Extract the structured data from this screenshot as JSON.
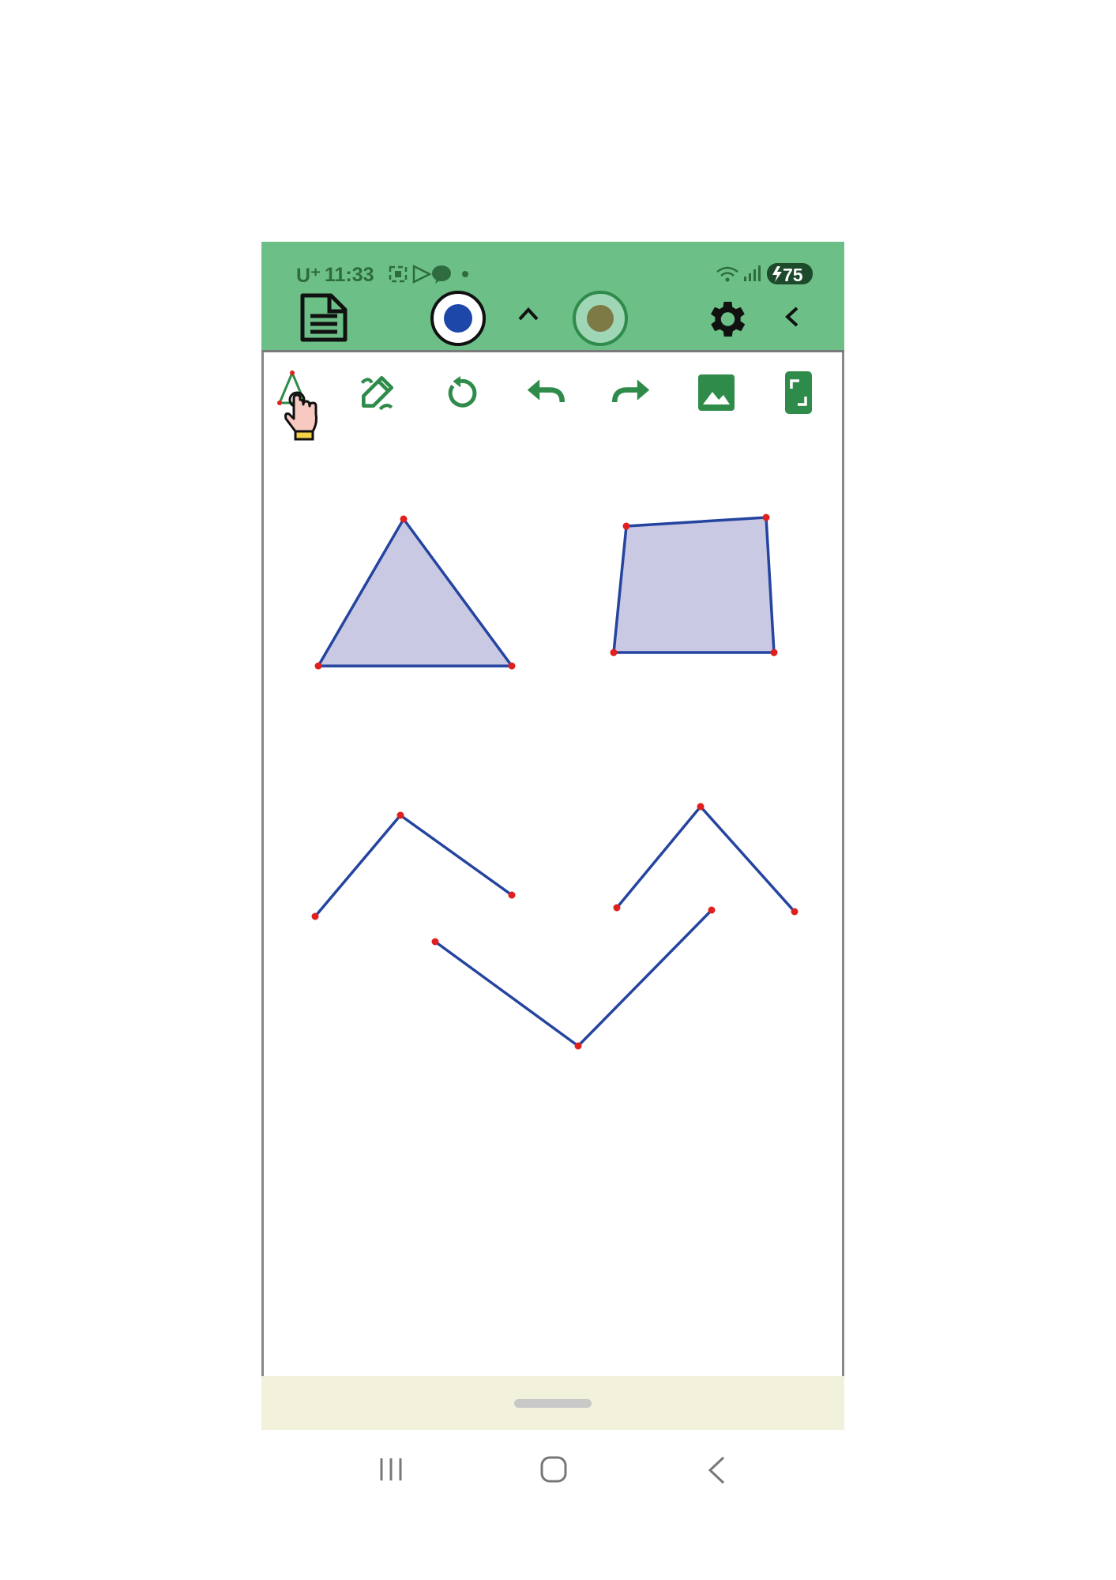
{
  "status_bar": {
    "carrier": "U⁺",
    "time": "11:33",
    "battery": "75",
    "notification_icons": [
      "screenshot-icon",
      "play-store-icon",
      "kakaotalk-icon",
      "dot-icon"
    ],
    "system_icons": [
      "wifi-icon",
      "signal-icon",
      "battery-charging-icon"
    ]
  },
  "app_toolbar": {
    "icons": [
      "document-icon",
      "record-button-icon",
      "chevron-up-icon",
      "camera-toggle-icon",
      "settings-gear-icon",
      "chevron-left-icon"
    ]
  },
  "tool_row": {
    "icons": [
      "polygon-tool-icon",
      "draw-edit-icon",
      "reset-rotate-icon",
      "undo-icon",
      "redo-icon",
      "image-icon",
      "fullscreen-icon"
    ],
    "selected": "polygon-tool-icon"
  },
  "drawing": {
    "line_color": "#2444a0",
    "fill_color": "#c9c9e4",
    "vertex_color": "#e0201e",
    "shapes": [
      "triangle",
      "quadrilateral",
      "angle-left",
      "angle-right",
      "angle-bottom"
    ]
  },
  "colors": {
    "toolbar_bg": "#6bbf87",
    "icon_green": "#2e8b4a",
    "gesture_bar_bg": "#f2f1dc"
  },
  "nav_bar": {
    "icons": [
      "recent-apps-icon",
      "home-icon",
      "back-icon"
    ]
  }
}
